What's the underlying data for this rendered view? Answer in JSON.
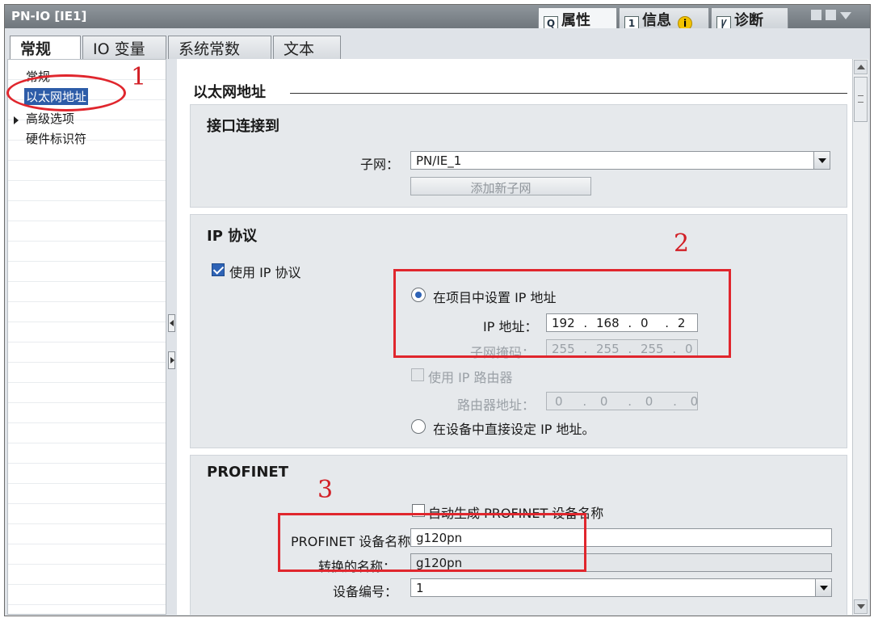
{
  "window": {
    "title": "PN-IO [IE1]",
    "tabs": [
      {
        "label": "属性",
        "icon": "properties-icon",
        "active": true
      },
      {
        "label": "信息",
        "icon": "info-list-icon",
        "active": false
      },
      {
        "label": "诊断",
        "icon": "diagnostics-icon",
        "active": false
      }
    ],
    "controls": [
      "restore-icon",
      "minimize-icon",
      "menu-arrow-icon"
    ]
  },
  "main_tabs": [
    {
      "label": "常规",
      "active": true
    },
    {
      "label": "IO 变量",
      "active": false
    },
    {
      "label": "系统常数",
      "active": false
    },
    {
      "label": "文本",
      "active": false
    }
  ],
  "nav": {
    "items": [
      {
        "label": "常规",
        "selected": false,
        "expandable": false
      },
      {
        "label": "以太网地址",
        "selected": true,
        "expandable": false
      },
      {
        "label": "高级选项",
        "selected": false,
        "expandable": true
      },
      {
        "label": "硬件标识符",
        "selected": false,
        "expandable": false
      }
    ]
  },
  "content": {
    "section_title": "以太网地址",
    "interface": {
      "title": "接口连接到",
      "subnet_label": "子网：",
      "subnet_value": "PN/IE_1",
      "add_subnet_button": "添加新子网"
    },
    "ip": {
      "title": "IP 协议",
      "use_ip_label": "使用 IP 协议",
      "use_ip_checked": true,
      "set_in_project_label": "在项目中设置 IP 地址",
      "set_in_project_selected": true,
      "ip_address_label": "IP 地址：",
      "ip_address": [
        "192",
        "168",
        "0",
        "2"
      ],
      "subnet_mask_label": "子网掩码：",
      "subnet_mask": [
        "255",
        "255",
        "255",
        "0"
      ],
      "use_router_label": "使用 IP 路由器",
      "use_router_checked": false,
      "router_address_label": "路由器地址：",
      "router_address": [
        "0",
        "0",
        "0",
        "0"
      ],
      "set_on_device_label": "在设备中直接设定 IP 地址。",
      "set_on_device_selected": false
    },
    "profinet": {
      "title": "PROFINET",
      "auto_name_label": "自动生成 PROFINET 设备名称",
      "auto_name_checked": false,
      "device_name_label": "PROFINET 设备名称",
      "device_name": "g120pn",
      "converted_name_label": "转换的名称：",
      "converted_name": "g120pn",
      "device_number_label": "设备编号：",
      "device_number": "1"
    }
  },
  "annotations": {
    "num1": "1",
    "num2": "2",
    "num3": "3",
    "color": "#e0262d"
  },
  "colors": {
    "selection": "#2d5ca8",
    "group_bg": "#e6e9ec",
    "titlebar": "#7a8187"
  }
}
